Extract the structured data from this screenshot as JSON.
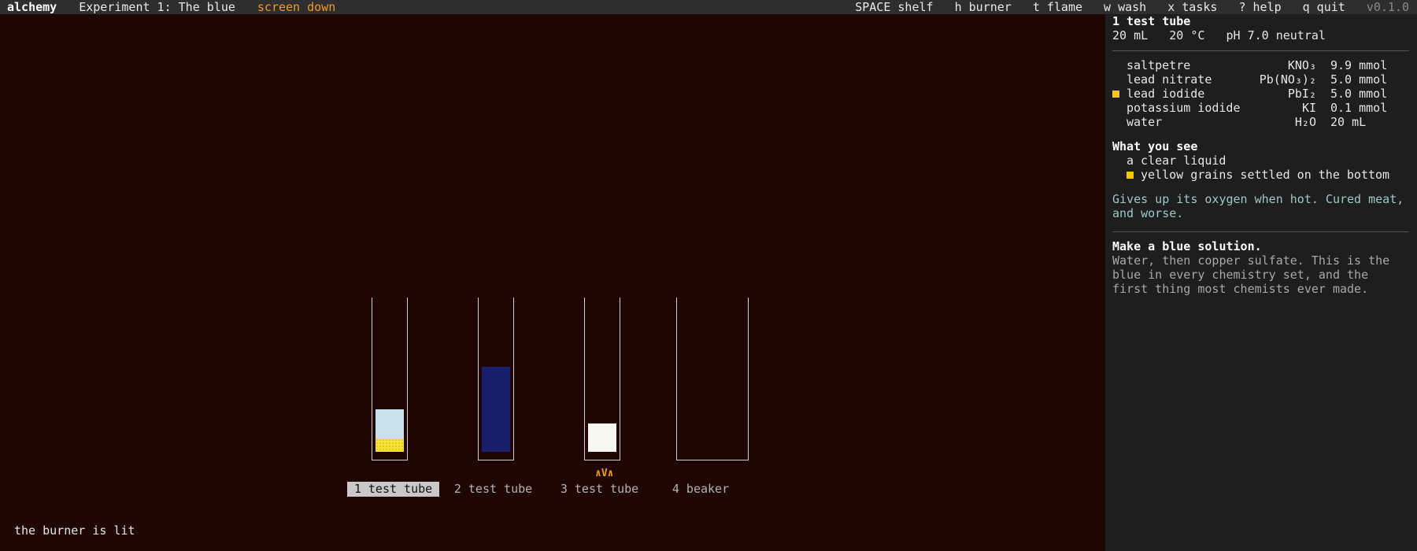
{
  "topbar": {
    "app": "alchemy",
    "experiment": "Experiment 1: The blue",
    "status": "screen down",
    "keys": [
      "SPACE shelf",
      "h burner",
      "t flame",
      "w wash",
      "x tasks",
      "? help",
      "q quit"
    ],
    "version": "v0.1.0"
  },
  "vessels": [
    {
      "label": "1 test tube",
      "selected": true
    },
    {
      "label": "2 test tube",
      "selected": false
    },
    {
      "label": "3 test tube",
      "selected": false,
      "heat": "∧V∧"
    },
    {
      "label": "4 beaker",
      "selected": false
    }
  ],
  "message": "the burner is lit",
  "panel": {
    "title": "1 test tube",
    "stats": "20 mL   20 °C   pH 7.0 neutral",
    "contents": [
      {
        "name": "saltpetre",
        "formula": "KNO₃",
        "amount": "9.9 mmol",
        "marker": false
      },
      {
        "name": "lead nitrate",
        "formula": "Pb(NO₃)₂",
        "amount": "5.0 mmol",
        "marker": false
      },
      {
        "name": "lead iodide",
        "formula": "PbI₂",
        "amount": "5.0 mmol",
        "marker": true
      },
      {
        "name": "potassium iodide",
        "formula": "KI",
        "amount": "0.1 mmol",
        "marker": false
      },
      {
        "name": "water",
        "formula": "H₂O",
        "amount": "20 mL",
        "marker": false
      }
    ],
    "see_title": "What you see",
    "observations": [
      {
        "text": "a clear liquid",
        "marker": false
      },
      {
        "text": "yellow grains settled on the bottom",
        "marker": true
      }
    ],
    "description_1": "Gives up its oxygen when hot. Cured meat,",
    "description_2": "and worse.",
    "task_title": "Make a blue solution.",
    "task_1": "Water, then copper sulfate. This is the",
    "task_2": "blue in every chemistry set, and the",
    "task_3": "first thing most chemists ever made."
  },
  "colors": {
    "background": "#1f0605",
    "accent": "#f39a1e",
    "panel": "#1e1e1e",
    "tube1_liquid": "#c8dfec",
    "tube1_sediment": "#f5e23a",
    "tube2_liquid": "#1a1f6b",
    "tube3_contents": "#f7f7f2",
    "marker": "#f5c518"
  }
}
